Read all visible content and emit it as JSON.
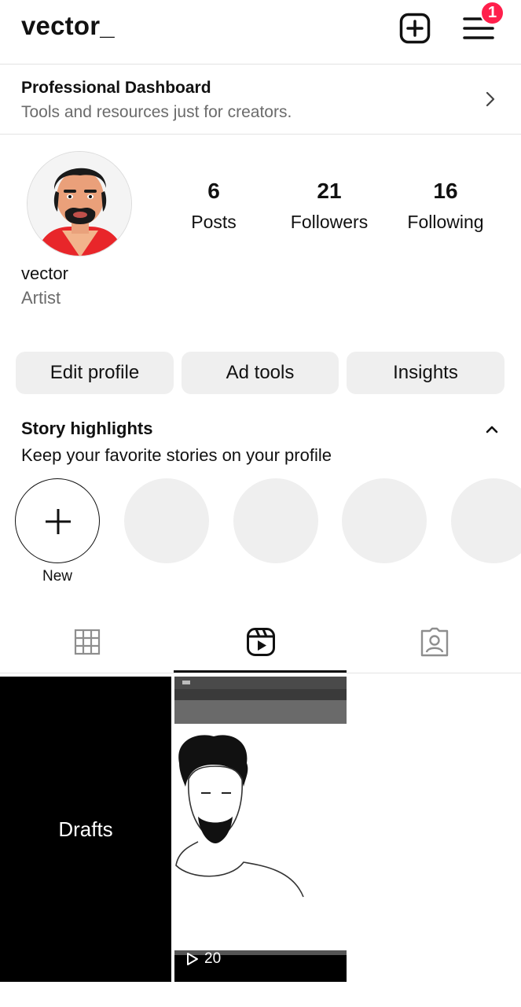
{
  "header": {
    "username": "vector_",
    "notification_count": "1",
    "add_icon": "plus-square-icon",
    "menu_icon": "hamburger-menu-icon"
  },
  "dashboard": {
    "title": "Professional Dashboard",
    "subtitle": "Tools and resources just for creators."
  },
  "profile": {
    "name": "vector",
    "category": "Artist",
    "stats": {
      "posts": {
        "count": "6",
        "label": "Posts"
      },
      "followers": {
        "count": "21",
        "label": "Followers"
      },
      "following": {
        "count": "16",
        "label": "Following"
      }
    }
  },
  "actions": {
    "edit_profile": "Edit profile",
    "ad_tools": "Ad tools",
    "insights": "Insights"
  },
  "highlights": {
    "title": "Story highlights",
    "subtitle": "Keep your favorite stories on your profile",
    "new_label": "New"
  },
  "tabs": {
    "items": [
      "grid-icon",
      "reels-icon",
      "tagged-icon"
    ],
    "active": "reels-icon"
  },
  "grid": {
    "drafts_label": "Drafts",
    "reel_view_count": "20"
  },
  "colors": {
    "badge": "#ff1f4b",
    "button_bg": "#efefef",
    "muted_text": "#6b6b6b"
  }
}
